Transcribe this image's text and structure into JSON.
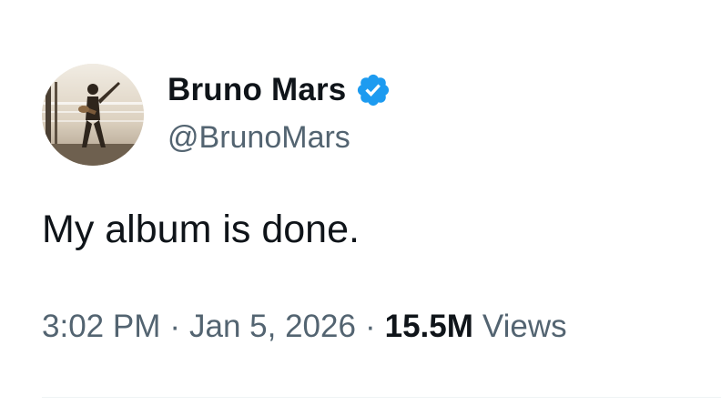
{
  "author": {
    "display_name": "Bruno Mars",
    "handle": "@BrunoMars",
    "verified": true,
    "verified_icon": "verified-badge-icon",
    "verified_color": "#1d9bf0"
  },
  "tweet": {
    "text": "My album is done."
  },
  "meta": {
    "time": "3:02 PM",
    "separator": "·",
    "date": "Jan 5, 2026",
    "views_count": "15.5M",
    "views_label": "Views"
  },
  "colors": {
    "primary_text": "#0f1419",
    "secondary_text": "#536471",
    "divider": "#eff3f4"
  }
}
